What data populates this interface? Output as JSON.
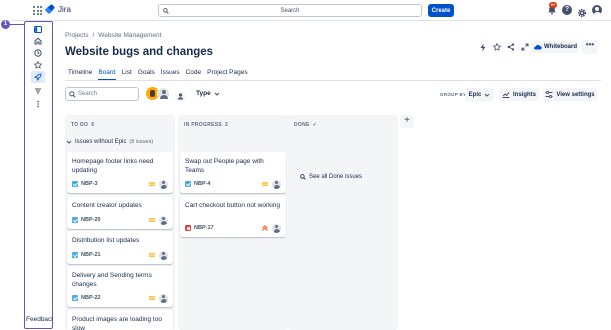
{
  "topbar": {
    "product_name": "Jira",
    "search_placeholder": "Search",
    "create_label": "Create",
    "notifications_count": "9+",
    "help_label": "?"
  },
  "overlay": {
    "step_number": "1"
  },
  "sidebar": {
    "icons": [
      "sidebar-panel-icon",
      "home-icon",
      "clock-icon",
      "star-icon",
      "rocket-icon",
      "filter-icon",
      "more-vertical-icon"
    ],
    "active_index": 4,
    "feedback_label": "Feedbacl"
  },
  "breadcrumb": {
    "projects": "Projects",
    "separator": "/",
    "project": "Website Management"
  },
  "page": {
    "title": "Website bugs and changes",
    "whiteboard_label": "Whiteboard",
    "more_label": "•••"
  },
  "tabs": [
    {
      "label": "Timeline"
    },
    {
      "label": "Board"
    },
    {
      "label": "List"
    },
    {
      "label": "Goals"
    },
    {
      "label": "Issues"
    },
    {
      "label": "Code"
    },
    {
      "label": "Project Pages"
    }
  ],
  "active_tab": "Board",
  "filters": {
    "search_placeholder": "Search",
    "type_label": "Type",
    "group_by_label": "GROUP BY",
    "group_by_value": "Epic",
    "insights_label": "Insights",
    "view_settings_label": "View settings"
  },
  "columns": {
    "todo": {
      "name": "TO DO",
      "count": "6"
    },
    "progress": {
      "name": "IN PROGRESS",
      "count": "2"
    },
    "done": {
      "name": "DONE",
      "check": "✓"
    }
  },
  "swimlane": {
    "label": "Issues without Epic",
    "count": "(8 issues)"
  },
  "cards": {
    "todo": [
      {
        "title": "Homepage footer links need updating",
        "key": "NBP-3",
        "type": "task",
        "priority": "medium"
      },
      {
        "title": "Content creator updates",
        "key": "NBP-20",
        "type": "task",
        "priority": "medium"
      },
      {
        "title": "Distribution list updates",
        "key": "NBP-21",
        "type": "task",
        "priority": "medium"
      },
      {
        "title": "Delivery and Sending terms changes",
        "key": "NBP-22",
        "type": "task",
        "priority": "medium"
      },
      {
        "title": "Product images are loading too slow",
        "key": "",
        "type": "task",
        "priority": ""
      }
    ],
    "progress": [
      {
        "title": "Swap out People page with Teams",
        "key": "NBP-4",
        "type": "task",
        "priority": "medium"
      },
      {
        "title": "Cart checkout button not working",
        "key": "NBP-17",
        "type": "bug",
        "priority": "high"
      }
    ]
  },
  "done_link": "See all Done issues",
  "colors": {
    "accent": "#0052cc",
    "highlight": "#6554c0",
    "column_bg": "#f4f5f7",
    "task": "#4bade8",
    "bug": "#e5493a",
    "medium_priority": "#ffab00",
    "high_priority": "#ff5630"
  }
}
